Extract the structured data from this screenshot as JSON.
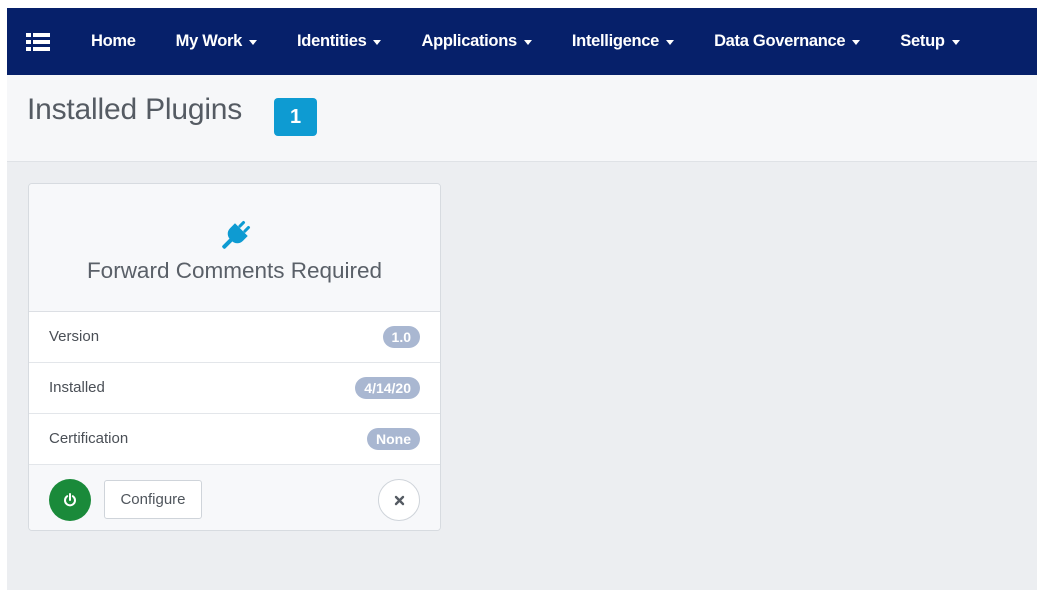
{
  "nav": {
    "menu_icon": "list-menu-icon",
    "items": [
      {
        "label": "Home",
        "dropdown": false
      },
      {
        "label": "My Work",
        "dropdown": true
      },
      {
        "label": "Identities",
        "dropdown": true
      },
      {
        "label": "Applications",
        "dropdown": true
      },
      {
        "label": "Intelligence",
        "dropdown": true
      },
      {
        "label": "Data Governance",
        "dropdown": true
      },
      {
        "label": "Setup",
        "dropdown": true
      }
    ]
  },
  "page": {
    "title": "Installed Plugins",
    "count": "1"
  },
  "plugin": {
    "icon": "plug-icon",
    "name": "Forward Comments Required",
    "rows": [
      {
        "label": "Version",
        "value": "1.0"
      },
      {
        "label": "Installed",
        "value": "4/14/20"
      },
      {
        "label": "Certification",
        "value": "None"
      }
    ],
    "actions": {
      "enable_icon": "power-icon",
      "configure_label": "Configure",
      "remove_icon": "close-icon"
    }
  },
  "colors": {
    "navbar": "#06206a",
    "accent": "#0e9bd2",
    "badge": "#a9b7d1",
    "power_button": "#1a8a3a",
    "background": "#eceef1"
  }
}
